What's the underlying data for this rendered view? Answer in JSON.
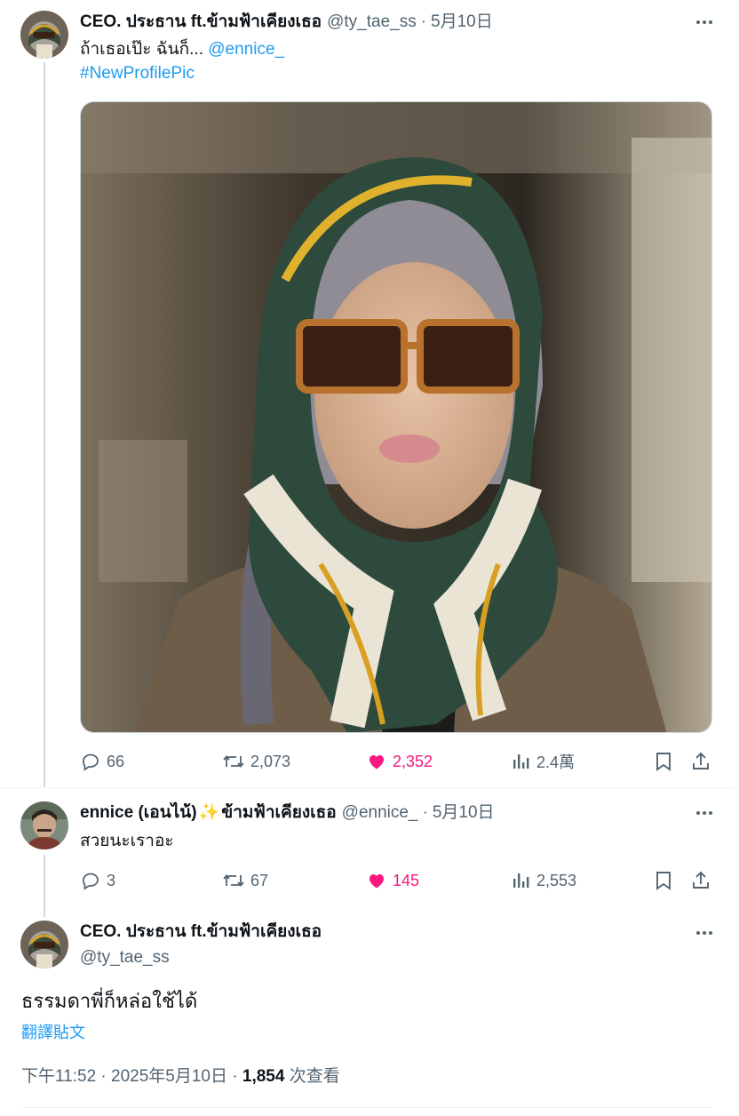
{
  "tweet1": {
    "name": "CEO. ประธาน ft.ข้ามฟ้าเคียงเธอ",
    "handle": "@ty_tae_ss",
    "sep": "·",
    "date": "5月10日",
    "text_line1": "ถ้าเธอเป๊ะ ฉันก็...",
    "mention": "@ennice_",
    "hashtag": "#NewProfilePic",
    "stats": {
      "replies": "66",
      "reposts": "2,073",
      "likes": "2,352",
      "views": "2.4萬"
    }
  },
  "tweet2": {
    "name": "ennice (เอนไน้)",
    "sparkle": "✨",
    "name_suffix": "ข้ามฟ้าเคียงเธอ",
    "handle": "@ennice_",
    "sep": "·",
    "date": "5月10日",
    "text": "สวยนะเราอะ",
    "stats": {
      "replies": "3",
      "reposts": "67",
      "likes": "145",
      "views": "2,553"
    }
  },
  "tweet3": {
    "name": "CEO. ประธาน ft.ข้ามฟ้าเคียงเธอ",
    "handle": "@ty_tae_ss",
    "text": "ธรรมดาพี่ก็หล่อใช้ได้",
    "translate": "翻譯貼文",
    "time": "下午11:52 · 2025年5月10日 · ",
    "views_count": "1,854",
    "views_label": " 次查看"
  },
  "icons": {
    "reply": "reply-icon",
    "repost": "repost-icon",
    "like": "heart-icon",
    "views": "views-icon",
    "bookmark": "bookmark-icon",
    "share": "share-icon",
    "more": "more-icon"
  },
  "colors": {
    "link": "#1d9bf0",
    "like": "#f91880",
    "muted": "#536471",
    "text": "#0f1419"
  }
}
